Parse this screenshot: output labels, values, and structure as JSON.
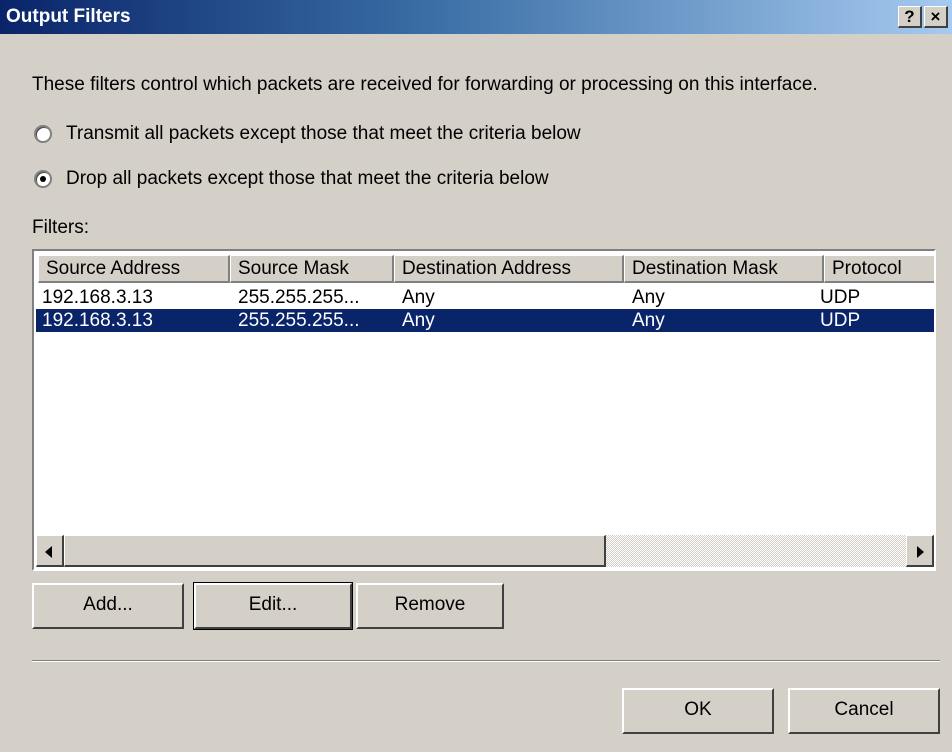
{
  "window": {
    "title": "Output Filters",
    "help_label": "?",
    "close_label": "×"
  },
  "description": "These filters control which packets are received for forwarding or processing on this interface.",
  "options": [
    {
      "label": "Transmit all packets except those that meet the criteria below",
      "selected": false
    },
    {
      "label": "Drop all packets except those that meet the criteria below",
      "selected": true
    }
  ],
  "filters_label": "Filters:",
  "table": {
    "columns": [
      "Source Address",
      "Source Mask",
      "Destination Address",
      "Destination Mask",
      "Protocol"
    ],
    "rows": [
      {
        "cells": [
          "192.168.3.13",
          "255.255.255...",
          "Any",
          "Any",
          "UDP"
        ],
        "selected": false
      },
      {
        "cells": [
          "192.168.3.13",
          "255.255.255...",
          "Any",
          "Any",
          "UDP"
        ],
        "selected": true
      }
    ]
  },
  "buttons": {
    "add": "Add...",
    "edit": "Edit...",
    "remove": "Remove",
    "ok": "OK",
    "cancel": "Cancel"
  },
  "colors": {
    "title_start": "#0a246a",
    "title_end": "#a6caf0",
    "selection": "#0a246a",
    "face": "#d4d0c8"
  }
}
